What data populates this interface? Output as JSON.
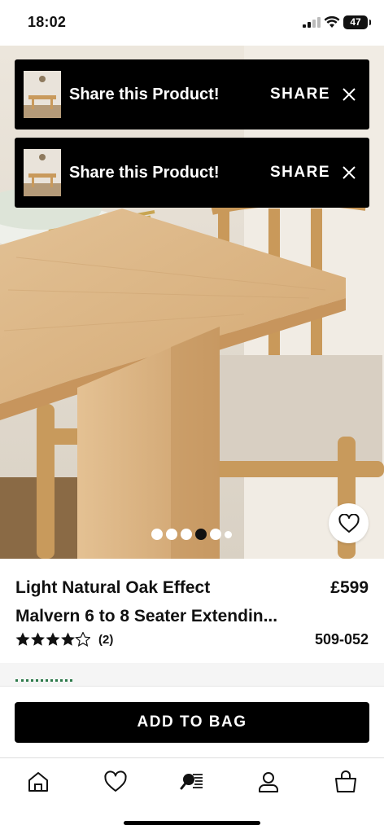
{
  "status_bar": {
    "time": "18:02",
    "battery": "47"
  },
  "banners": [
    {
      "title": "Share this Product!",
      "action": "SHARE"
    },
    {
      "title": "Share this Product!",
      "action": "SHARE"
    }
  ],
  "carousel": {
    "total": 6,
    "active_index": 3
  },
  "product": {
    "title_line1": "Light Natural Oak Effect",
    "title_line2": "Malvern 6 to 8 Seater Extendin...",
    "price": "£599",
    "rating": 4.5,
    "review_count": "(2)",
    "sku": "509-052"
  },
  "cta": {
    "add_to_bag": "ADD TO BAG"
  },
  "nav": {
    "items": [
      {
        "icon": "home-icon"
      },
      {
        "icon": "heart-icon"
      },
      {
        "icon": "search-list-icon"
      },
      {
        "icon": "account-icon"
      },
      {
        "icon": "bag-icon"
      }
    ]
  },
  "colors": {
    "brand_black": "#000000",
    "oak": "#d9b47f"
  }
}
